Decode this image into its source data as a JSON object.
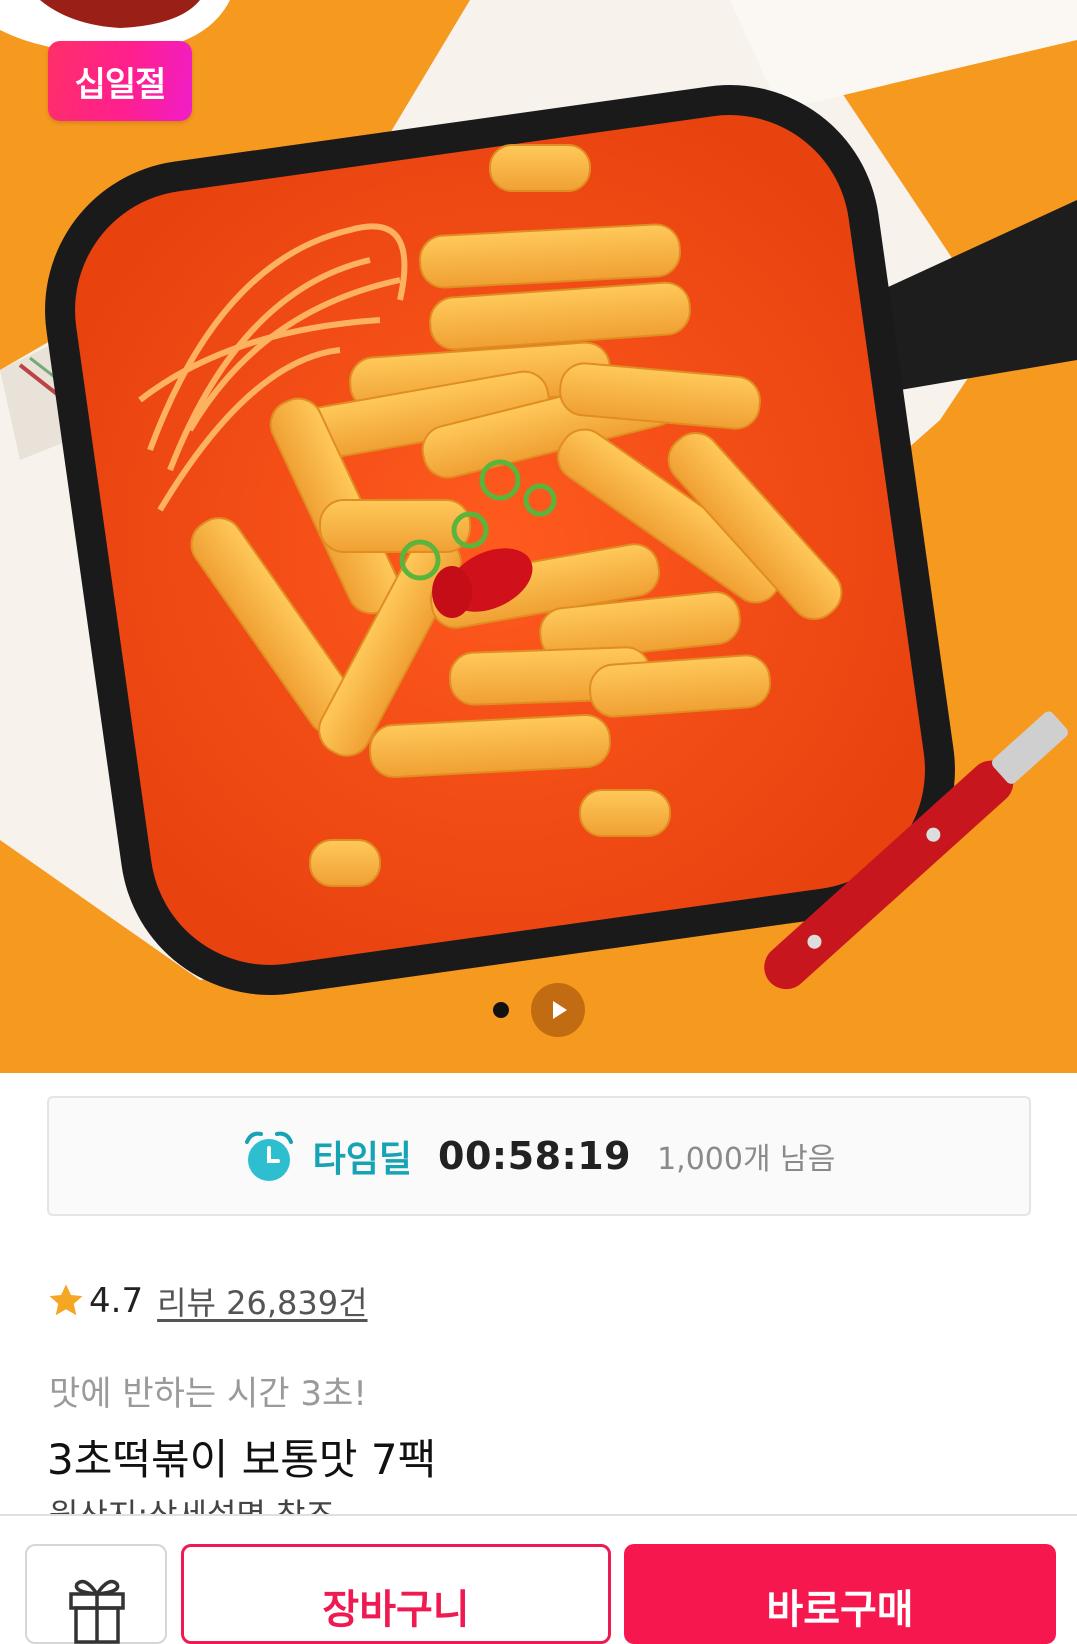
{
  "hero": {
    "badge": "십일절",
    "page_indicator": {
      "current": 1,
      "total": 1,
      "has_video": true
    },
    "icons": {
      "play": "play-icon"
    }
  },
  "timedeal": {
    "icon": "alarm-clock-icon",
    "label": "타임딜",
    "timer": "00:58:19",
    "remaining": "1,000개 남음"
  },
  "rating": {
    "icon": "star-icon",
    "score": "4.7",
    "review_link": "리뷰 26,839건"
  },
  "product": {
    "subtitle": "맛에 반하는 시간 3초!",
    "title": "3초떡볶이 보통맛 7팩",
    "origin_partial": "원산지:상세설명 참조"
  },
  "bottom_bar": {
    "gift_icon": "gift-icon",
    "cart_label": "장바구니",
    "buy_label": "바로구매"
  },
  "colors": {
    "accent": "#f5174d",
    "timedeal": "#16a3b4",
    "badge_start": "#ff2f68",
    "badge_end": "#f01ec8",
    "star": "#f5a623"
  }
}
